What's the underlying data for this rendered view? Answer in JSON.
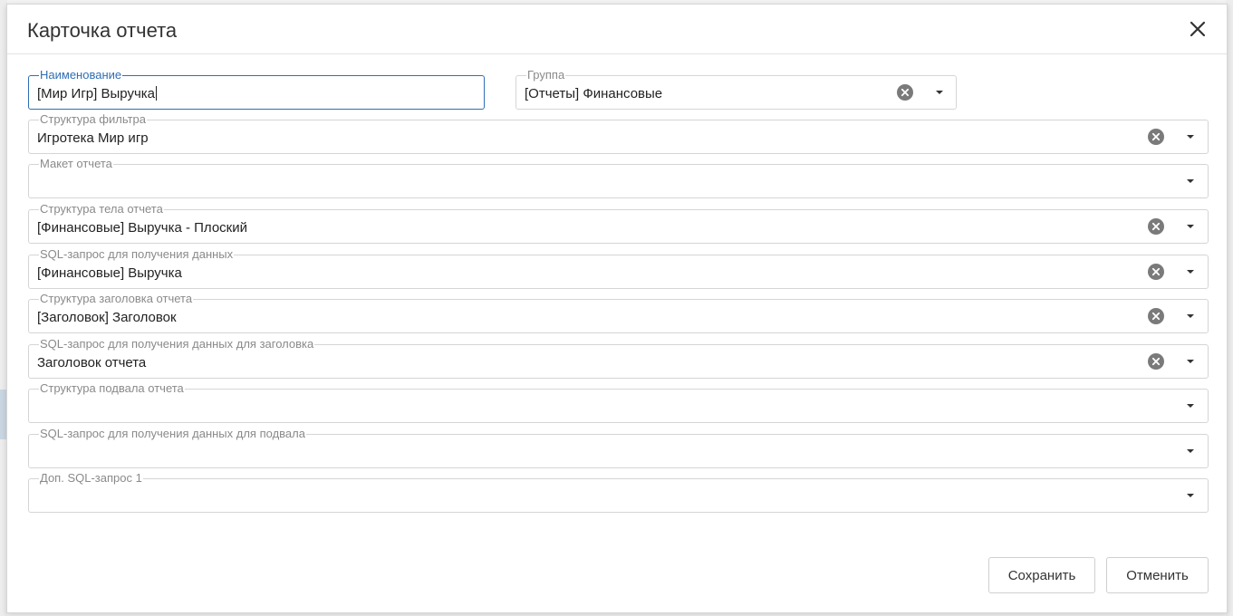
{
  "dialog": {
    "title": "Карточка отчета"
  },
  "fields": {
    "name": {
      "label": "Наименование",
      "value": "[Мир Игр] Выручка"
    },
    "group": {
      "label": "Группа",
      "value": "[Отчеты] Финансовые"
    },
    "filter_structure": {
      "label": "Структура фильтра",
      "value": "Игротека Мир игр"
    },
    "report_layout": {
      "label": "Макет отчета",
      "value": ""
    },
    "body_structure": {
      "label": "Структура тела отчета",
      "value": "[Финансовые] Выручка - Плоский"
    },
    "sql_data": {
      "label": "SQL-запрос для получения данных",
      "value": "[Финансовые] Выручка"
    },
    "header_structure": {
      "label": "Структура заголовка отчета",
      "value": "[Заголовок] Заголовок"
    },
    "sql_header": {
      "label": "SQL-запрос для получения данных для заголовка",
      "value": "Заголовок отчета"
    },
    "footer_structure": {
      "label": "Структура подвала отчета",
      "value": ""
    },
    "sql_footer": {
      "label": "SQL-запрос для получения данных для подвала",
      "value": ""
    },
    "extra_sql_1": {
      "label": "Доп. SQL-запрос 1",
      "value": ""
    }
  },
  "buttons": {
    "save": "Сохранить",
    "cancel": "Отменить"
  },
  "icons": {
    "close": "close-icon",
    "clear": "clear-circle-icon",
    "dropdown": "caret-down-icon"
  },
  "colors": {
    "focus_accent": "#2f6eb5",
    "border": "#d5d5d5",
    "label": "#8a8a8a"
  }
}
